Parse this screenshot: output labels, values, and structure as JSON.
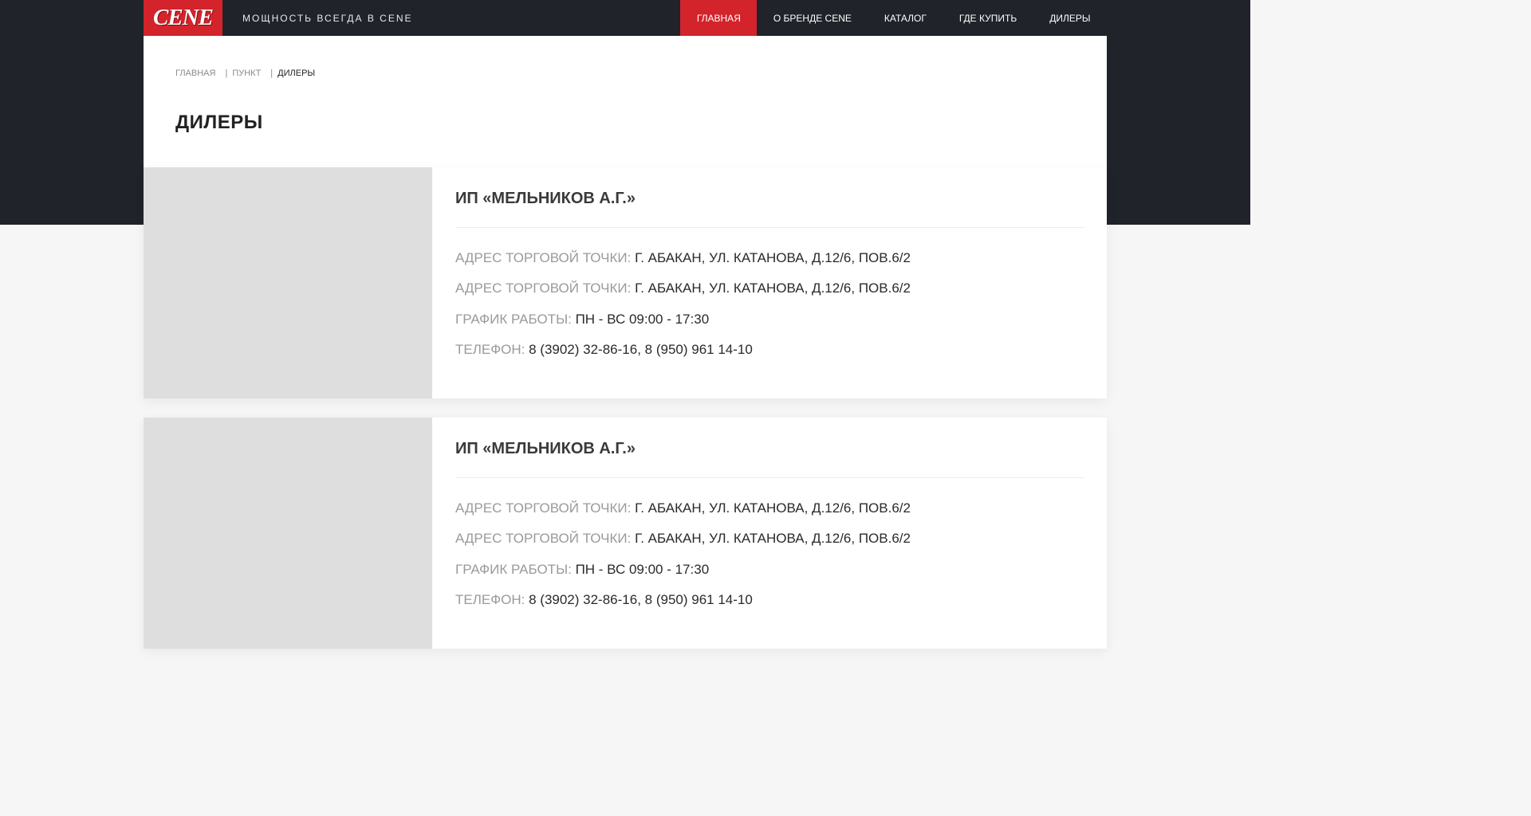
{
  "header": {
    "logo_text": "CENE",
    "tagline": "МОЩНОСТЬ ВСЕГДА В CENE",
    "menu": [
      {
        "label": "ГЛАВНАЯ",
        "active": true
      },
      {
        "label": "О БРЕНДЕ CENE",
        "active": false
      },
      {
        "label": "КАТАЛОГ",
        "active": false
      },
      {
        "label": "ГДЕ КУПИТЬ",
        "active": false
      },
      {
        "label": "ДИЛЕРЫ",
        "active": false
      }
    ]
  },
  "breadcrumb": {
    "items": [
      "ГЛАВНАЯ",
      "ПУНКТ",
      "ДИЛЕРЫ"
    ],
    "separator": "|"
  },
  "page": {
    "title": "ДИЛЕРЫ"
  },
  "dealers": [
    {
      "name": "ИП «МЕЛЬНИКОВ А.Г.»",
      "rows": [
        {
          "label": "АДРЕС ТОРГОВОЙ ТОЧКИ:",
          "value": "Г. АБАКАН, УЛ. КАТАНОВА, Д.12/6, ПОВ.6/2"
        },
        {
          "label": "АДРЕС ТОРГОВОЙ ТОЧКИ:",
          "value": "Г. АБАКАН, УЛ. КАТАНОВА, Д.12/6, ПОВ.6/2"
        },
        {
          "label": "ГРАФИК РАБОТЫ:",
          "value": "ПН - ВС 09:00 - 17:30"
        },
        {
          "label": "ТЕЛЕФОН:",
          "value": "8 (3902) 32-86-16, 8 (950) 961 14-10"
        }
      ]
    },
    {
      "name": "ИП «МЕЛЬНИКОВ А.Г.»",
      "rows": [
        {
          "label": "АДРЕС ТОРГОВОЙ ТОЧКИ:",
          "value": "Г. АБАКАН, УЛ. КАТАНОВА, Д.12/6, ПОВ.6/2"
        },
        {
          "label": "АДРЕС ТОРГОВОЙ ТОЧКИ:",
          "value": "Г. АБАКАН, УЛ. КАТАНОВА, Д.12/6, ПОВ.6/2"
        },
        {
          "label": "ГРАФИК РАБОТЫ:",
          "value": "ПН - ВС 09:00 - 17:30"
        },
        {
          "label": "ТЕЛЕФОН:",
          "value": "8 (3902) 32-86-16, 8 (950) 961 14-10"
        }
      ]
    }
  ],
  "colors": {
    "accent": "#d3232b",
    "dark_background": "#20232a",
    "page_background": "#f6f6f7",
    "image_placeholder": "#dedede",
    "label_gray": "#9a9a9a"
  }
}
